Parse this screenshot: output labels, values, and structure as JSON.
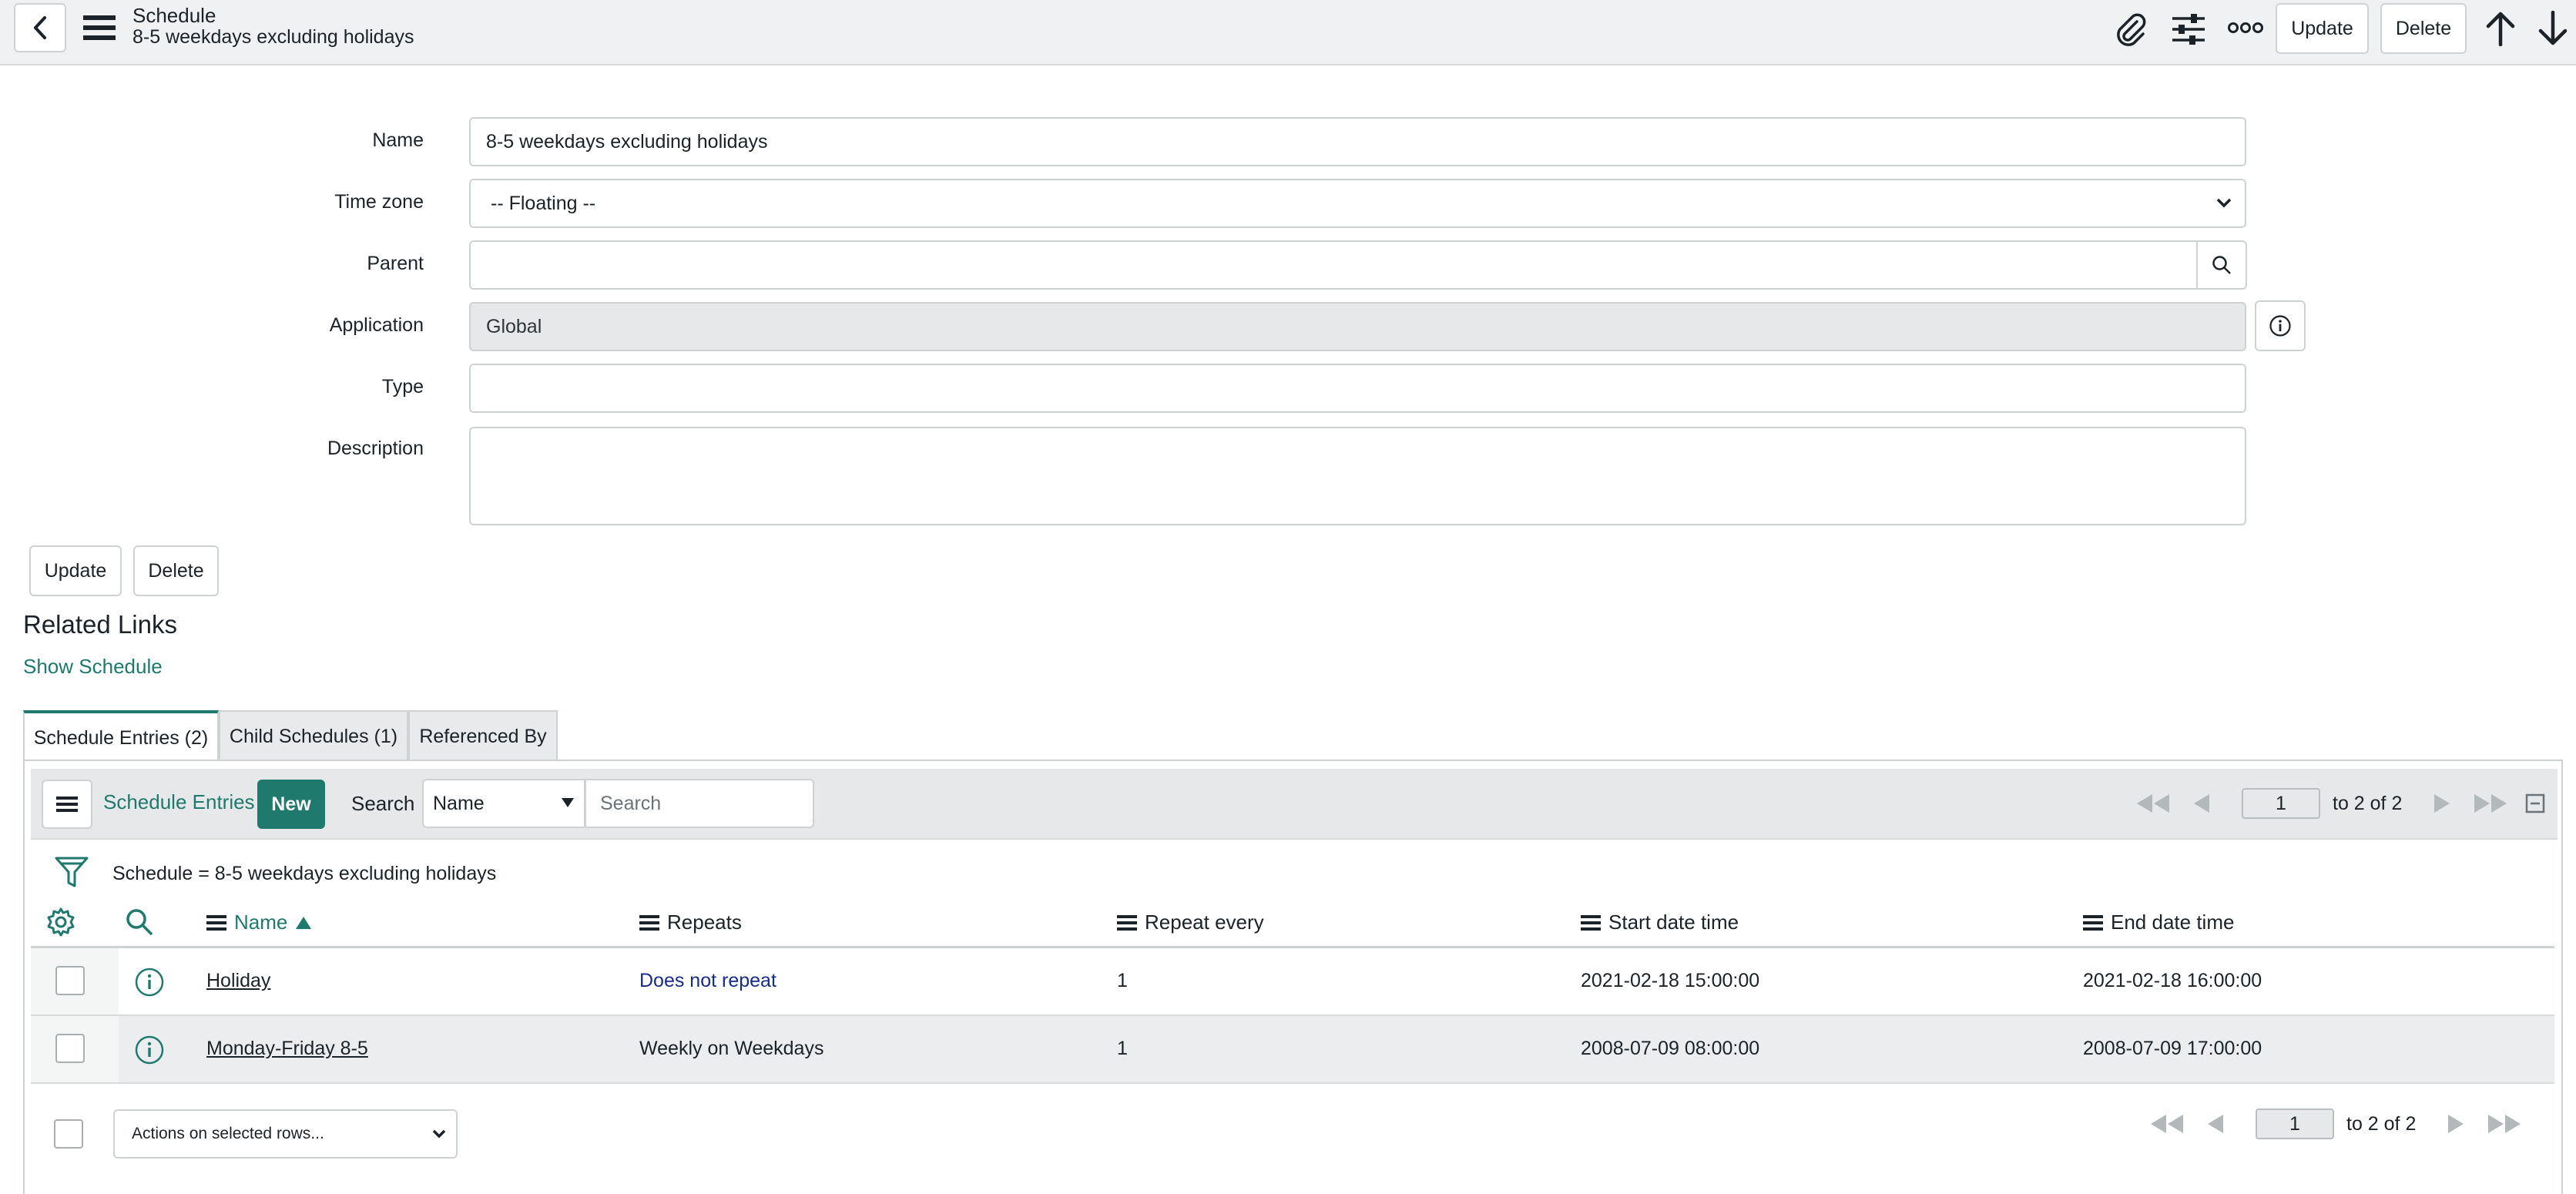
{
  "header": {
    "title": "Schedule",
    "subtitle": "8-5 weekdays excluding holidays",
    "update_label": "Update",
    "delete_label": "Delete"
  },
  "form": {
    "name": {
      "label": "Name",
      "value": "8-5 weekdays excluding holidays"
    },
    "timezone": {
      "label": "Time zone",
      "value": "-- Floating --"
    },
    "parent": {
      "label": "Parent",
      "value": ""
    },
    "application": {
      "label": "Application",
      "value": "Global"
    },
    "type": {
      "label": "Type",
      "value": ""
    },
    "description": {
      "label": "Description",
      "value": ""
    },
    "update_label": "Update",
    "delete_label": "Delete"
  },
  "related": {
    "title": "Related Links",
    "show_schedule": "Show Schedule"
  },
  "tabs": [
    {
      "label": "Schedule Entries (2)",
      "active": true
    },
    {
      "label": "Child Schedules (1)",
      "active": false
    },
    {
      "label": "Referenced By",
      "active": false
    }
  ],
  "list": {
    "title": "Schedule Entries",
    "new_label": "New",
    "search_label": "Search",
    "search_field": "Name",
    "search_placeholder": "Search",
    "page": "1",
    "page_of": "to 2 of 2",
    "filter": "Schedule = 8-5 weekdays excluding holidays",
    "columns": [
      "Name",
      "Repeats",
      "Repeat every",
      "Start date time",
      "End date time"
    ],
    "rows": [
      {
        "name": "Holiday",
        "repeats": "Does not repeat",
        "repeat_every": "1",
        "start": "2021-02-18 15:00:00",
        "end": "2021-02-18 16:00:00"
      },
      {
        "name": "Monday-Friday 8-5",
        "repeats": "Weekly on Weekdays",
        "repeat_every": "1",
        "start": "2008-07-09 08:00:00",
        "end": "2008-07-09 17:00:00"
      }
    ],
    "actions_placeholder": "Actions on selected rows...",
    "bottom_page": "1",
    "bottom_page_of": "to 2 of 2"
  },
  "colors": {
    "accent": "#1f7a6d",
    "link_blue": "#172b8c"
  }
}
